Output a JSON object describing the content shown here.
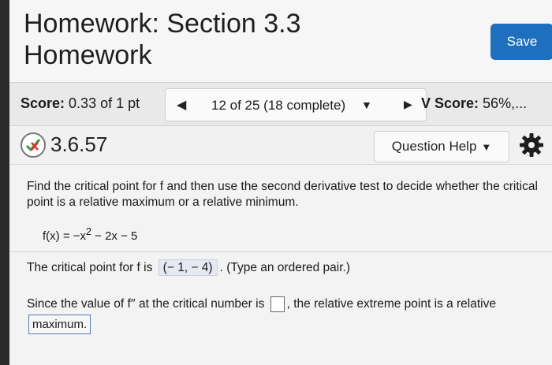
{
  "header": {
    "title_line1": "Homework: Section 3.3",
    "title_line2": "Homework",
    "save_label": "Save"
  },
  "score_bar": {
    "score_label": "Score:",
    "score_value": "0.33 of 1 pt",
    "prev_icon": "triangle-left",
    "nav_text": "12 of 25 (18 complete)",
    "nav_caret": "triangle-down",
    "next_icon": "triangle-right",
    "hw_score_label": "V Score:",
    "hw_score_value": "56%,..."
  },
  "question": {
    "number": "3.6.57",
    "status_icon": "partial-credit-icon",
    "help_label": "Question Help",
    "settings_icon": "gear-icon"
  },
  "content": {
    "instructions": "Find the critical point for f and then use the second derivative test to decide whether the critical point is a relative maximum or a relative minimum.",
    "function_prefix": "f(x) = −x",
    "function_exp": "2",
    "function_suffix": " − 2x − 5",
    "answer1_before": "The critical point for f is",
    "answer1_value": "(− 1, − 4)",
    "answer1_after": ". (Type an ordered pair.)",
    "answer2_before": "Since the value of f′′ at the critical number is",
    "answer2_after": ", the relative extreme point is a relative",
    "answer2_dropdown": "maximum."
  },
  "colors": {
    "save_button": "#1f6fbf",
    "answer_highlight": "#e6e9f2"
  }
}
